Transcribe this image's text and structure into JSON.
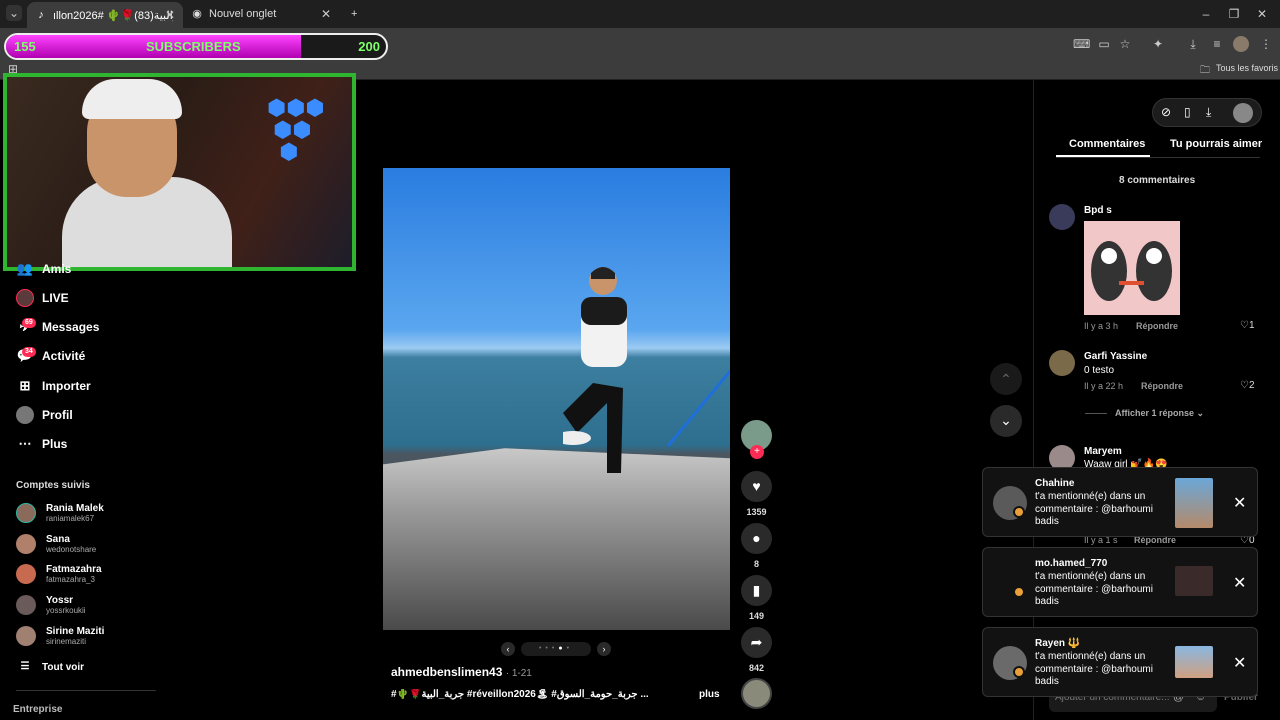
{
  "browser": {
    "tabs": [
      {
        "title": "ıllon2026# 🌵🌹جربة_البية(83)",
        "active": true
      },
      {
        "title": "Nouvel onglet",
        "active": false
      }
    ],
    "url_fragment": "3514464022049",
    "bookmarks_label": "Tous les favoris"
  },
  "overlay": {
    "sub_current": "155",
    "sub_label": "SUBSCRIBERS",
    "sub_goal": "200",
    "sub_progress": 0.775
  },
  "nav": {
    "items": [
      {
        "label": "Amis",
        "icon": "friends-icon"
      },
      {
        "label": "LIVE",
        "icon": "live-icon"
      },
      {
        "label": "Messages",
        "icon": "messages-icon",
        "badge": "69"
      },
      {
        "label": "Activité",
        "icon": "activity-icon",
        "badge": "34"
      },
      {
        "label": "Importer",
        "icon": "upload-icon"
      },
      {
        "label": "Profil",
        "icon": "profile-icon"
      },
      {
        "label": "Plus",
        "icon": "more-icon"
      }
    ],
    "following_title": "Comptes suivis",
    "following": [
      {
        "name": "Rania Malek",
        "handle": "raniamalek67"
      },
      {
        "name": "Sana",
        "handle": "wedonotshare"
      },
      {
        "name": "Fatmazahra",
        "handle": "fatmazahra_3"
      },
      {
        "name": "Yossr",
        "handle": "yossrkoukii"
      },
      {
        "name": "Sirine Maziti",
        "handle": "sirinemaziti"
      }
    ],
    "see_all": "Tout voir",
    "footer": "Entreprise"
  },
  "post": {
    "author": "ahmedbenslimen43",
    "date": "1-21",
    "caption": "#🌵🌹جربة_البية #réveillon2026🏝 #جربة_حومة_السوق ...",
    "more": "plus",
    "likes": "1359",
    "comments": "8",
    "saves": "149",
    "shares": "842"
  },
  "panel": {
    "tab_comments": "Commentaires",
    "tab_suggestions": "Tu pourrais aimer",
    "count_label": "8 commentaires",
    "comments": [
      {
        "name": "Bpd s",
        "text": "",
        "time": "Il y a 3 h",
        "reply": "Répondre",
        "likes": "1"
      },
      {
        "name": "Garfi Yassine",
        "text": "0 testo",
        "time": "Il y a 22 h",
        "reply": "Répondre",
        "likes": "2"
      },
      {
        "name": "Maryem",
        "text": "Waaw girl 💅🔥😍",
        "time": "Il y a 1 s",
        "reply": "Répondre",
        "likes": "0"
      }
    ],
    "show_replies": "Afficher 1 réponse",
    "add_comment_placeholder": "Ajouter un commentaire...",
    "publish": "Publier"
  },
  "notifications": [
    {
      "name": "Chahine",
      "text": "t'a mentionné(e) dans un commentaire : @barhoumi badis"
    },
    {
      "name": "mo.hamed_770",
      "text": "t'a mentionné(e) dans un commentaire : @barhoumi badis"
    },
    {
      "name": "Rayen 🔱",
      "text": "t'a mentionné(e) dans un commentaire : @barhoumi badis"
    }
  ],
  "colors": {
    "accent": "#fe2c55",
    "sub_fill": "#e040e0",
    "sub_text": "#7dff6a",
    "webcam_border": "#2fb52f"
  }
}
